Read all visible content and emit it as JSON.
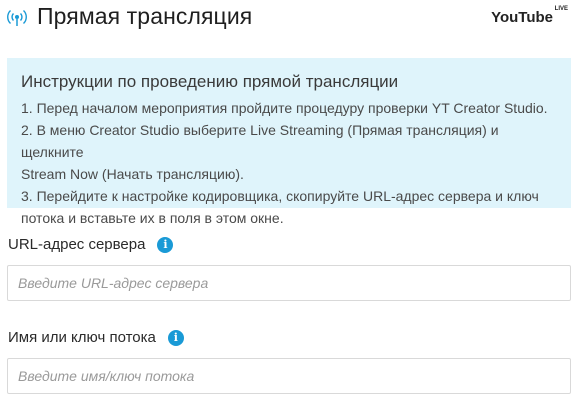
{
  "header": {
    "title": "Прямая трансляция",
    "brand_name": "YouTube",
    "brand_suffix": "LIVE",
    "icon": "broadcast-icon",
    "accent_color": "#1a9ad6"
  },
  "instructions": {
    "title": "Инструкции по проведению прямой трансляции",
    "lines": [
      "1. Перед началом мероприятия пройдите процедуру проверки YT Creator Studio.",
      "2. В меню Creator Studio выберите Live Streaming (Прямая трансляция) и щелкните",
      "Stream Now (Начать трансляцию).",
      "3. Перейдите к настройке кодировщика, скопируйте URL-адрес сервера и ключ",
      "потока и вставьте их в поля в этом окне."
    ],
    "background": "#dff4fb"
  },
  "fields": {
    "server_url": {
      "label": "URL-адрес сервера",
      "placeholder": "Введите URL-адрес сервера",
      "value": ""
    },
    "stream_key": {
      "label": "Имя или ключ потока",
      "placeholder": "Введите имя/ключ потока",
      "value": ""
    },
    "info_icon": "info-icon"
  }
}
